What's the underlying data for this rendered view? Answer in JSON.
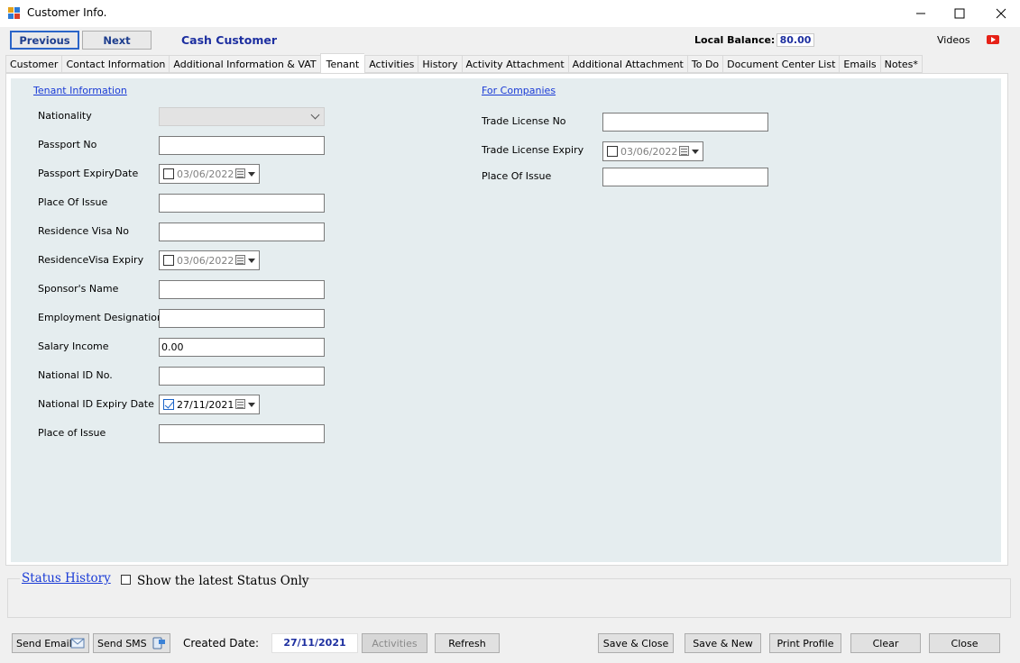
{
  "window": {
    "title": "Customer Info.",
    "minimize": "—",
    "maximize": "☐",
    "close": "✕"
  },
  "header": {
    "previous_label": "Previous",
    "next_label": "Next",
    "customer_name": "Cash Customer",
    "local_balance_label": "Local Balance:",
    "local_balance_value": "80.00",
    "videos_label": "Videos"
  },
  "tabs": [
    {
      "label": "Customer"
    },
    {
      "label": "Contact Information"
    },
    {
      "label": "Additional Information & VAT"
    },
    {
      "label": "Tenant"
    },
    {
      "label": "Activities"
    },
    {
      "label": "History"
    },
    {
      "label": "Activity Attachment"
    },
    {
      "label": "Additional Attachment"
    },
    {
      "label": "To Do"
    },
    {
      "label": "Document Center List"
    },
    {
      "label": "Emails"
    },
    {
      "label": "Notes*"
    }
  ],
  "active_tab": "Tenant",
  "tenant": {
    "section_title": "Tenant Information",
    "nationality_label": "Nationality",
    "nationality_value": "",
    "passport_no_label": "Passport No",
    "passport_no_value": "",
    "passport_expiry_label": "Passport ExpiryDate",
    "passport_expiry_value": "03/06/2022",
    "passport_place_label": "Place Of Issue",
    "passport_place_value": "",
    "residence_visa_no_label": "Residence Visa No",
    "residence_visa_no_value": "",
    "residence_visa_expiry_label": "ResidenceVisa Expiry",
    "residence_visa_expiry_value": "03/06/2022",
    "sponsor_label": "Sponsor's Name",
    "sponsor_value": "",
    "employment_label": "Employment Designation",
    "employment_value": "",
    "salary_label": "Salary Income",
    "salary_value": "0.00",
    "national_id_label": "National ID No.",
    "national_id_value": "",
    "national_id_expiry_label": "National ID Expiry Date",
    "national_id_expiry_value": "27/11/2021",
    "national_id_expiry_checked": true,
    "id_place_label": "Place of Issue",
    "id_place_value": ""
  },
  "companies": {
    "section_title": "For Companies",
    "trade_license_label": "Trade License No",
    "trade_license_value": "",
    "trade_license_expiry_label": "Trade License Expiry",
    "trade_license_expiry_value": "03/06/2022",
    "place_label": "Place Of Issue",
    "place_value": ""
  },
  "status": {
    "link_label": "Status History",
    "show_latest_label": "Show the latest Status Only"
  },
  "footer": {
    "send_email_label": "Send Email",
    "send_sms_label": "Send SMS",
    "created_date_label": "Created Date:",
    "created_date_value": "27/11/2021",
    "activities_label": "Activities",
    "refresh_label": "Refresh",
    "save_close_label": "Save & Close",
    "save_new_label": "Save & New",
    "print_profile_label": "Print Profile",
    "clear_label": "Clear",
    "close_label": "Close"
  },
  "colors": {
    "accent_blue": "#1d2fa0",
    "link_blue": "#1a3bd6",
    "panel_bg": "#e5edef",
    "youtube_red": "#e62117"
  }
}
